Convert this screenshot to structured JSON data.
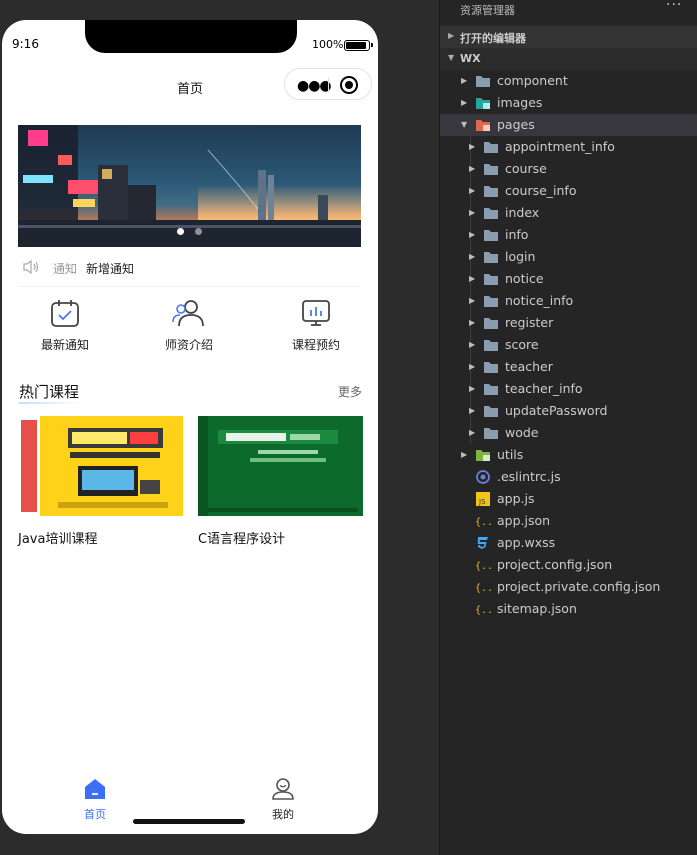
{
  "status_bar": {
    "time": "9:16",
    "battery": "100%"
  },
  "nav": {
    "title": "首页"
  },
  "notice": {
    "tag": "通知",
    "text": "新增通知"
  },
  "menu": [
    {
      "label": "最新通知",
      "icon": "calendar-check-icon"
    },
    {
      "label": "师资介绍",
      "icon": "users-icon"
    },
    {
      "label": "课程预约",
      "icon": "presentation-chart-icon"
    }
  ],
  "hot_courses": {
    "title": "热门课程",
    "more": "更多",
    "items": [
      {
        "name": "Java培训课程"
      },
      {
        "name": "C语言程序设计"
      }
    ]
  },
  "tabbar": [
    {
      "label": "首页",
      "icon": "home-icon",
      "active": true,
      "color": "#3b6ff5"
    },
    {
      "label": "我的",
      "icon": "user-icon",
      "active": false,
      "color": "#222222"
    }
  ],
  "explorer": {
    "header": "资源管理器",
    "sections": {
      "open_editors": "打开的编辑器",
      "root": "WX"
    },
    "items": {
      "component": "component",
      "images": "images",
      "pages": "pages",
      "appointment_info": "appointment_info",
      "course": "course",
      "course_info": "course_info",
      "index": "index",
      "info": "info",
      "login": "login",
      "notice": "notice",
      "notice_info": "notice_info",
      "register": "register",
      "score": "score",
      "teacher": "teacher",
      "teacher_info": "teacher_info",
      "updatePassword": "updatePassword",
      "wode": "wode",
      "utils": "utils",
      "eslintrc": ".eslintrc.js",
      "app_js": "app.js",
      "app_json": "app.json",
      "app_wxss": "app.wxss",
      "project_config": "project.config.json",
      "project_private_config": "project.private.config.json",
      "sitemap": "sitemap.json"
    }
  }
}
